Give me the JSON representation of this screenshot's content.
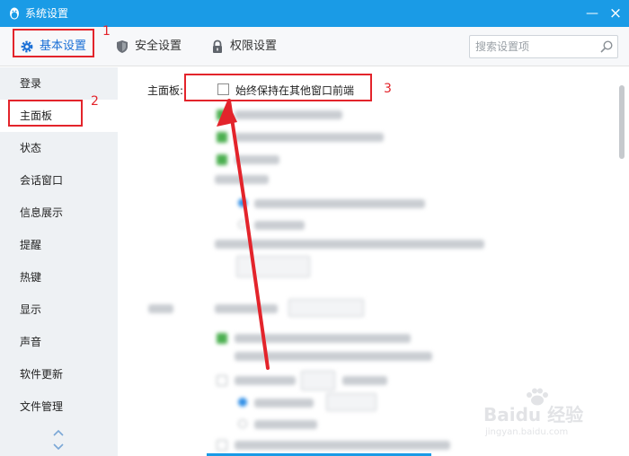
{
  "window": {
    "title": "系统设置"
  },
  "toolbar": {
    "tabs": [
      {
        "label": "基本设置",
        "icon": "gear-icon"
      },
      {
        "label": "安全设置",
        "icon": "shield-icon"
      },
      {
        "label": "权限设置",
        "icon": "lock-icon"
      }
    ],
    "search_placeholder": "搜索设置项"
  },
  "sidebar": {
    "items": [
      {
        "label": "登录"
      },
      {
        "label": "主面板"
      },
      {
        "label": "状态"
      },
      {
        "label": "会话窗口"
      },
      {
        "label": "信息展示"
      },
      {
        "label": "提醒"
      },
      {
        "label": "热键"
      },
      {
        "label": "显示"
      },
      {
        "label": "声音"
      },
      {
        "label": "软件更新"
      },
      {
        "label": "文件管理"
      }
    ],
    "active": "主面板"
  },
  "main": {
    "section_label": "主面板:",
    "option_label": "始终保持在其他窗口前端",
    "option_checked": false
  },
  "annotations": {
    "labels": [
      "1",
      "2",
      "3"
    ],
    "color": "#e3242b"
  },
  "watermark": {
    "brand": "Baidu 经验",
    "site": "jingyan.baidu.com"
  },
  "colors": {
    "accent": "#1a9be6",
    "sidebar_bg": "#eef1f4",
    "annotation": "#e3242b"
  }
}
